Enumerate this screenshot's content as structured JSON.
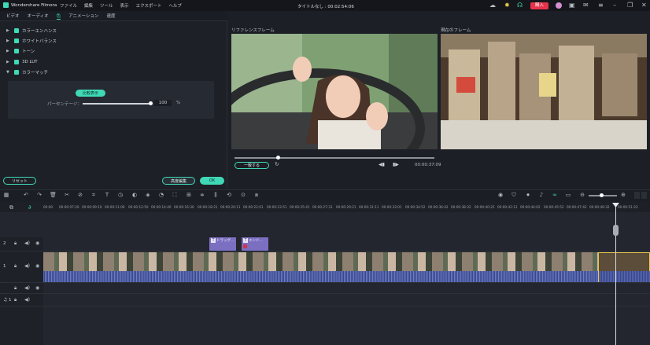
{
  "app": {
    "name": "Wondershare Filmora",
    "title": "タイトルなし : 00:02:54:06",
    "menu": [
      "ファイル",
      "編集",
      "ツール",
      "表示",
      "エクスポート",
      "ヘルプ"
    ],
    "buy_label": "購入"
  },
  "tabs": [
    "ビデオ",
    "オーディオ",
    "色",
    "アニメーション",
    "速度"
  ],
  "sections": [
    "カラーエンハンス",
    "ホワイトバランス",
    "トーン",
    "3D LUT",
    "カラーマッチ"
  ],
  "color_match": {
    "compare_label": "比較表示",
    "percentage_label": "パーセンテージ：",
    "percentage_value": "100",
    "percent_unit": "%",
    "percentage_level": 1.0
  },
  "panel_buttons": {
    "reset": "リセット",
    "advanced": "高度編集",
    "ok": "OK"
  },
  "viewers": {
    "reference_label": "リファレンスフレーム",
    "current_label": "現在のフレーム",
    "match_button": "一致する",
    "timecode": "00:00:37:09",
    "scrub_position": 0.2
  },
  "ruler": [
    "00:00",
    "00:00:07:20",
    "00:00:09:10",
    "00:00:11:00",
    "00:00:12:50",
    "00:00:14:40",
    "00:00:16:30",
    "00:00:18:21",
    "00:00:20:11",
    "00:00:22:01",
    "00:00:23:51",
    "00:00:25:41",
    "00:00:27:31",
    "00:00:29:21",
    "00:00:31:11",
    "00:00:33:01",
    "00:00:34:52",
    "00:00:36:42",
    "00:00:38:32",
    "00:00:40:22",
    "00:00:42:12",
    "00:00:44:02",
    "00:00:45:52",
    "00:00:47:42",
    "00:00:49:32",
    "00:00:51:23"
  ],
  "title_clips": [
    "ドラッグ...",
    "エンド..."
  ],
  "track_labels": [
    "2",
    "1",
    "1"
  ],
  "colors": {
    "accent": "#3fd9b7",
    "buy": "#e6334a",
    "clip_title": "#7b6fc2",
    "audio_wave": "#5566b3"
  }
}
